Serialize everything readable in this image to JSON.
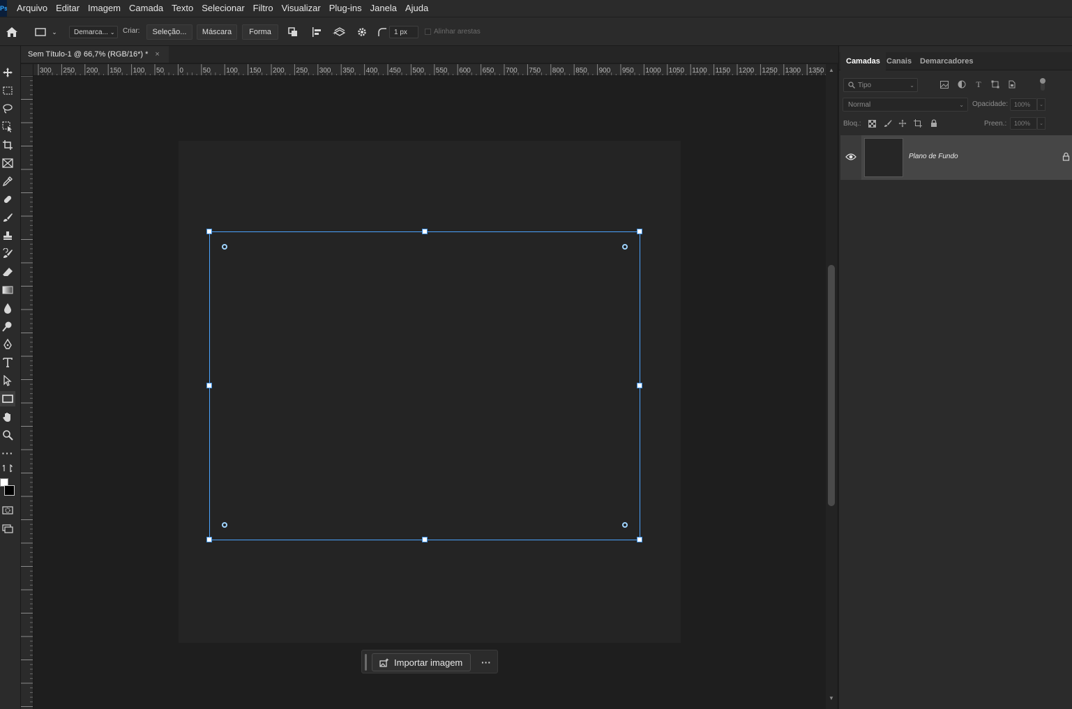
{
  "app": {
    "logo": "Ps"
  },
  "menu": [
    "Arquivo",
    "Editar",
    "Imagem",
    "Camada",
    "Texto",
    "Selecionar",
    "Filtro",
    "Visualizar",
    "Plug-ins",
    "Janela",
    "Ajuda"
  ],
  "options": {
    "mode_select": "Demarca...",
    "create_label": "Criar:",
    "selection_btn": "Seleção...",
    "mask_btn": "Máscara",
    "shape_btn": "Forma",
    "stroke_width": "1 px",
    "align_edges": "Alinhar arestas"
  },
  "document": {
    "tab_title": "Sem Título-1 @ 66,7% (RGB/16*) *",
    "close": "×"
  },
  "ruler": {
    "top_labels": [
      "300",
      "250",
      "200",
      "150",
      "100",
      "50",
      "0",
      "50",
      "100",
      "150",
      "200",
      "250",
      "300",
      "350",
      "400",
      "450",
      "500",
      "550",
      "600",
      "650",
      "700",
      "750",
      "800",
      "850",
      "900",
      "950",
      "1000",
      "1050",
      "1100",
      "1150",
      "1200",
      "1250",
      "1300",
      "1350"
    ]
  },
  "taskbar": {
    "import_label": "Importar imagem",
    "more": "···"
  },
  "panel": {
    "tabs": [
      "Camadas",
      "Canais",
      "Demarcadores"
    ],
    "active_tab": "Camadas",
    "filter_placeholder": "Tipo",
    "blend_mode": "Normal",
    "opacity_label": "Opacidade:",
    "opacity_value": "100%",
    "lock_label": "Bloq.:",
    "fill_label": "Preen.:",
    "fill_value": "100%",
    "layers": [
      {
        "name": "Plano de Fundo",
        "visible": true,
        "locked": true
      }
    ]
  },
  "colors": {
    "accent": "#4aa3ff",
    "bg": "#1e1e1e",
    "panel": "#2b2b2b"
  }
}
